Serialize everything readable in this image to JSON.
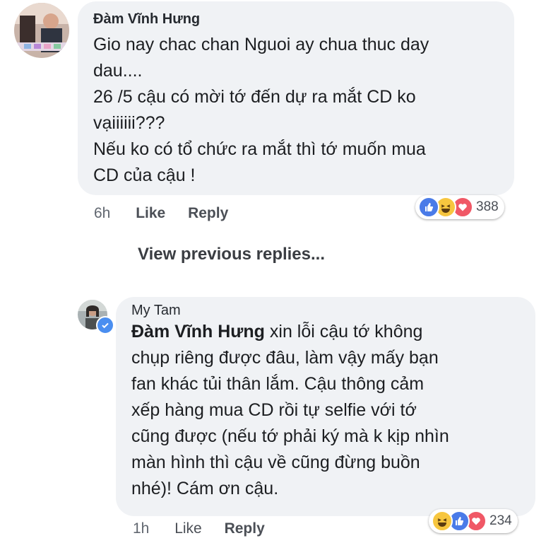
{
  "comment1": {
    "author": "Đàm Vĩnh Hưng",
    "lines": [
      "Gio nay chac chan Nguoi ay chua thuc day",
      "dau....",
      "26 /5 cậu có mời tớ đến dự ra mắt CD ko",
      "vạiiiiii???",
      "Nếu ko có tổ chức ra mắt thì tớ muốn mua",
      "CD của cậu !"
    ],
    "time": "6h",
    "like_label": "Like",
    "reply_label": "Reply",
    "reaction_count": "388",
    "reaction_icons": [
      "like-icon",
      "haha-icon",
      "love-icon"
    ]
  },
  "view_previous": "View previous replies...",
  "comment2": {
    "author": "My Tam",
    "mention": "Đàm Vĩnh Hưng",
    "first_line_rest": " xin lỗi cậu tớ không",
    "lines": [
      "chụp riêng được đâu, làm vậy mấy bạn",
      "fan khác tủi thân lắm. Cậu thông cảm",
      "xếp hàng mua CD rồi tự selfie với tớ",
      "cũng được (nếu tớ phải ký mà k kịp nhìn",
      "màn hình thì cậu về cũng đừng buồn",
      "nhé)! Cám ơn cậu."
    ],
    "time": "1h",
    "like_label": "Like",
    "reply_label": "Reply",
    "reaction_count": "234",
    "reaction_icons": [
      "haha-icon",
      "like-icon",
      "love-icon"
    ]
  },
  "colors": {
    "bubble": "#f0f2f5",
    "like_blue": "#4a7be8",
    "love_red": "#f05866",
    "haha_yellow": "#f7c63f"
  }
}
